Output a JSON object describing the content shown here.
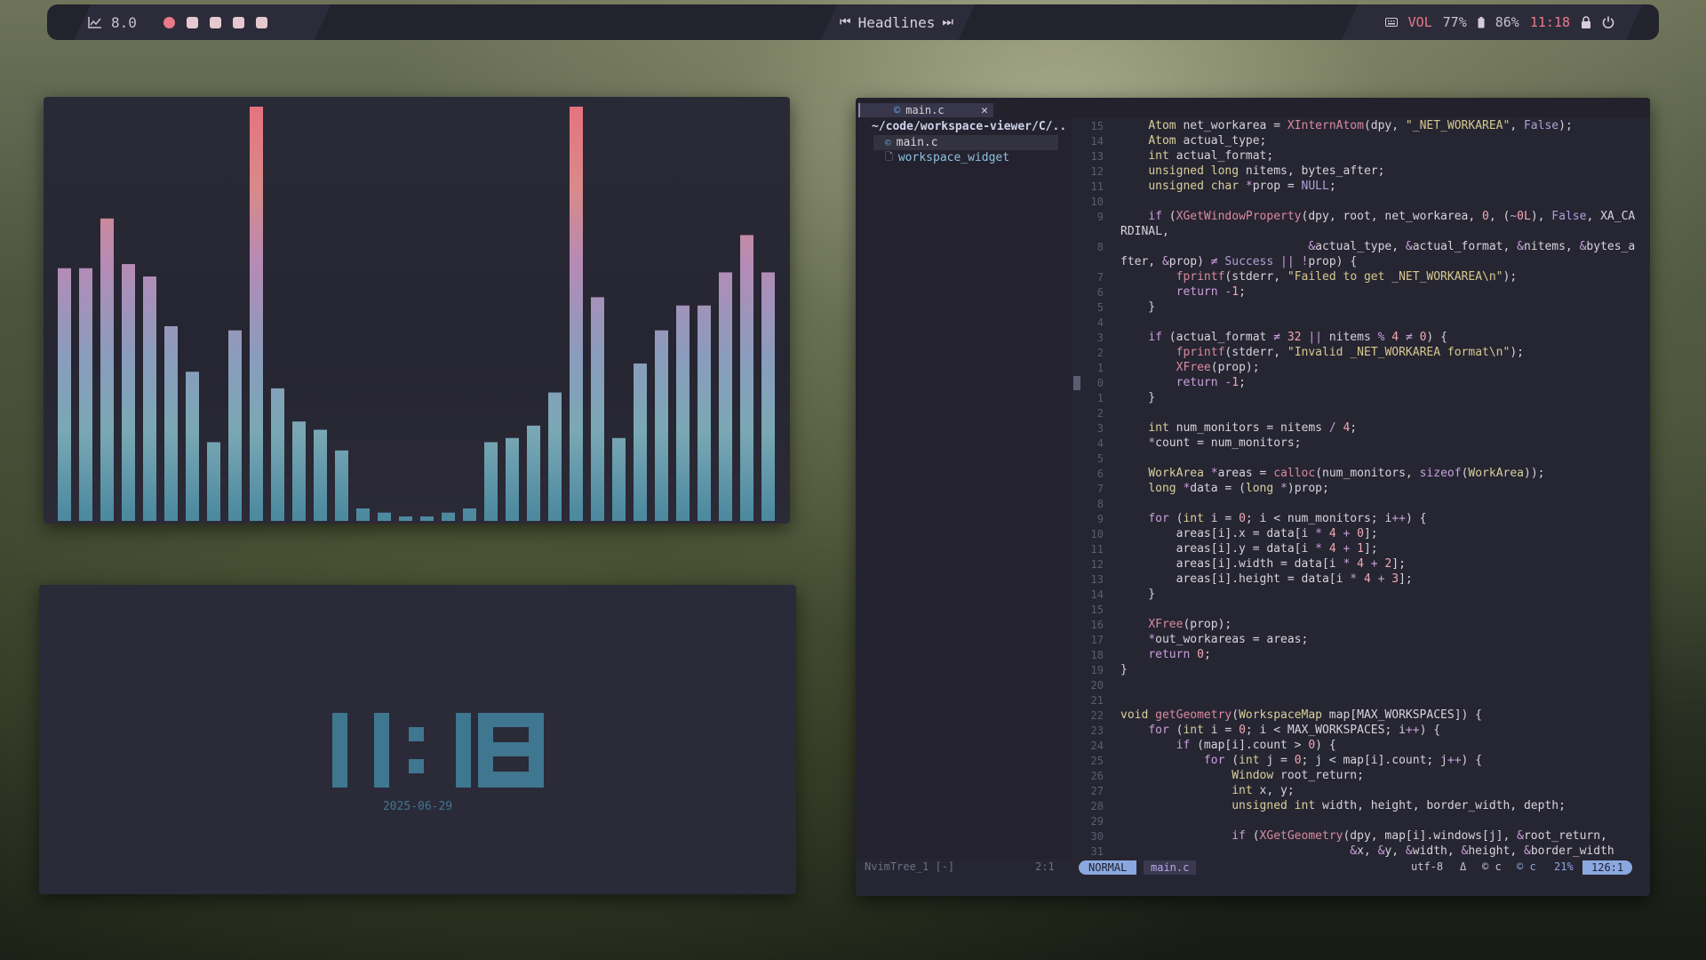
{
  "topbar": {
    "cpu_value": "8.0",
    "workspaces": [
      {
        "active": true
      },
      {
        "active": false
      },
      {
        "active": false
      },
      {
        "active": false
      },
      {
        "active": false
      }
    ],
    "media_title": "Headlines",
    "vol_label": "VOL",
    "vol_value": "77%",
    "battery_value": "86%",
    "time": "11:18",
    "colors": {
      "accent": "#ea7a88",
      "bar_bg": "#23232e"
    }
  },
  "visualizer": {
    "levels": [
      0.61,
      0.61,
      0.73,
      0.62,
      0.59,
      0.47,
      0.36,
      0.19,
      0.46,
      1.0,
      0.32,
      0.24,
      0.22,
      0.17,
      0.03,
      0.02,
      0.01,
      0.01,
      0.02,
      0.03,
      0.19,
      0.2,
      0.23,
      0.31,
      1.0,
      0.54,
      0.2,
      0.38,
      0.46,
      0.52,
      0.52,
      0.6,
      0.69,
      0.6
    ],
    "gradient": [
      "#e8707e",
      "#c58aa8",
      "#a789b8",
      "#7aa0b5",
      "#4f8aa0"
    ]
  },
  "clock": {
    "digits": "11:18",
    "date": "2025-06-29",
    "color": "#3f7690"
  },
  "editor": {
    "tab_name": "main.c",
    "tab_close": "✕",
    "tree": {
      "root": "~/code/workspace-viewer/C/..",
      "items": [
        {
          "name": "main.c",
          "icon": "c-file-icon",
          "selected": true
        },
        {
          "name": "workspace_widget",
          "icon": "file-icon",
          "selected": false
        }
      ]
    },
    "code_lines": [
      {
        "n": "15",
        "h": "    <span class=\"ty\">Atom</span> net_workarea = <span class=\"fn\">XInternAtom</span>(dpy, <span class=\"st\">\"_NET_WORKAREA\"</span>, <span class=\"cn\">False</span>);"
      },
      {
        "n": "14",
        "h": "    <span class=\"ty\">Atom</span> actual_type;"
      },
      {
        "n": "13",
        "h": "    <span class=\"ty\">int</span> actual_format;"
      },
      {
        "n": "12",
        "h": "    <span class=\"ty\">unsigned long</span> nitems, bytes_after;"
      },
      {
        "n": "11",
        "h": "    <span class=\"ty\">unsigned char</span> <span class=\"op\">*</span>prop = <span class=\"cn\">NULL</span>;"
      },
      {
        "n": "10",
        "h": ""
      },
      {
        "n": "9",
        "h": "    <span class=\"kw\">if</span> (<span class=\"fn\">XGetWindowProperty</span>(dpy, root, net_workarea, <span class=\"nm\">0</span>, (<span class=\"op\">~</span><span class=\"nm\">0L</span>), <span class=\"cn\">False</span>, XA_CA"
      },
      {
        "n": "",
        "h": "RDINAL,"
      },
      {
        "n": "8",
        "h": "                           <span class=\"op\">&amp;</span>actual_type, <span class=\"op\">&amp;</span>actual_format, <span class=\"op\">&amp;</span>nitems, <span class=\"op\">&amp;</span>bytes_a"
      },
      {
        "n": "",
        "h": "fter, <span class=\"op\">&amp;</span>prop) <span class=\"op\">≠</span> <span class=\"cn\">Success</span> <span class=\"op\">||</span> <span class=\"op\">!</span>prop) {"
      },
      {
        "n": "7",
        "h": "        <span class=\"fn\">fprintf</span>(stderr, <span class=\"st\">\"Failed to get _NET_WORKAREA\\n\"</span>);"
      },
      {
        "n": "6",
        "h": "        <span class=\"kw\">return</span> <span class=\"op\">-</span><span class=\"nm\">1</span>;"
      },
      {
        "n": "5",
        "h": "    }"
      },
      {
        "n": "4",
        "h": ""
      },
      {
        "n": "3",
        "h": "    <span class=\"kw\">if</span> (actual_format <span class=\"op\">≠</span> <span class=\"nm\">32</span> <span class=\"op\">||</span> nitems <span class=\"op\">%</span> <span class=\"nm\">4</span> <span class=\"op\">≠</span> <span class=\"nm\">0</span>) {"
      },
      {
        "n": "2",
        "h": "        <span class=\"fn\">fprintf</span>(stderr, <span class=\"st\">\"Invalid _NET_WORKAREA format\\n\"</span>);"
      },
      {
        "n": "1",
        "h": "        <span class=\"fn\">XFree</span>(prop);"
      },
      {
        "n": "0",
        "h": "        <span class=\"kw\">return</span> <span class=\"op\">-</span><span class=\"nm\">1</span>;",
        "cursor": true
      },
      {
        "n": "1",
        "h": "    }"
      },
      {
        "n": "2",
        "h": ""
      },
      {
        "n": "3",
        "h": "    <span class=\"ty\">int</span> num_monitors = nitems <span class=\"op\">/</span> <span class=\"nm\">4</span>;"
      },
      {
        "n": "4",
        "h": "    <span class=\"op\">*</span>count = num_monitors;"
      },
      {
        "n": "5",
        "h": ""
      },
      {
        "n": "6",
        "h": "    <span class=\"ty\">WorkArea</span> <span class=\"op\">*</span>areas = <span class=\"fn\">calloc</span>(num_monitors, <span class=\"kw\">sizeof</span>(<span class=\"ty\">WorkArea</span>));"
      },
      {
        "n": "7",
        "h": "    <span class=\"ty\">long</span> <span class=\"op\">*</span>data = (<span class=\"ty\">long</span> <span class=\"op\">*</span>)prop;"
      },
      {
        "n": "8",
        "h": ""
      },
      {
        "n": "9",
        "h": "    <span class=\"kw\">for</span> (<span class=\"ty\">int</span> i = <span class=\"nm\">0</span>; i &lt; num_monitors; i<span class=\"op\">++</span>) {"
      },
      {
        "n": "10",
        "h": "        areas[i].x = data[i <span class=\"op\">*</span> <span class=\"nm\">4</span> <span class=\"op\">+</span> <span class=\"nm\">0</span>];"
      },
      {
        "n": "11",
        "h": "        areas[i].y = data[i <span class=\"op\">*</span> <span class=\"nm\">4</span> <span class=\"op\">+</span> <span class=\"nm\">1</span>];"
      },
      {
        "n": "12",
        "h": "        areas[i].width = data[i <span class=\"op\">*</span> <span class=\"nm\">4</span> <span class=\"op\">+</span> <span class=\"nm\">2</span>];"
      },
      {
        "n": "13",
        "h": "        areas[i].height = data[i <span class=\"op\">*</span> <span class=\"nm\">4</span> <span class=\"op\">+</span> <span class=\"nm\">3</span>];"
      },
      {
        "n": "14",
        "h": "    }"
      },
      {
        "n": "15",
        "h": ""
      },
      {
        "n": "16",
        "h": "    <span class=\"fn\">XFree</span>(prop);"
      },
      {
        "n": "17",
        "h": "    <span class=\"op\">*</span>out_workareas = areas;"
      },
      {
        "n": "18",
        "h": "    <span class=\"kw\">return</span> <span class=\"nm\">0</span>;"
      },
      {
        "n": "19",
        "h": "}"
      },
      {
        "n": "20",
        "h": ""
      },
      {
        "n": "21",
        "h": ""
      },
      {
        "n": "22",
        "h": "<span class=\"ty\">void</span> <span class=\"fn\">getGeometry</span>(<span class=\"ty\">WorkspaceMap</span> map[MAX_WORKSPACES]) {"
      },
      {
        "n": "23",
        "h": "    <span class=\"kw\">for</span> (<span class=\"ty\">int</span> i = <span class=\"nm\">0</span>; i &lt; MAX_WORKSPACES; i<span class=\"op\">++</span>) {"
      },
      {
        "n": "24",
        "h": "        <span class=\"kw\">if</span> (map[i].count &gt; <span class=\"nm\">0</span>) {"
      },
      {
        "n": "25",
        "h": "            <span class=\"kw\">for</span> (<span class=\"ty\">int</span> j = <span class=\"nm\">0</span>; j &lt; map[i].count; j<span class=\"op\">++</span>) {"
      },
      {
        "n": "26",
        "h": "                <span class=\"ty\">Window</span> root_return;"
      },
      {
        "n": "27",
        "h": "                <span class=\"ty\">int</span> x, y;"
      },
      {
        "n": "28",
        "h": "                <span class=\"ty\">unsigned int</span> width, height, border_width, depth;"
      },
      {
        "n": "29",
        "h": ""
      },
      {
        "n": "30",
        "h": "                <span class=\"kw\">if</span> (<span class=\"fn\">XGetGeometry</span>(dpy, map[i].windows[j], <span class=\"op\">&amp;</span>root_return,"
      },
      {
        "n": "31",
        "h": "                                 <span class=\"op\">&amp;</span>x, <span class=\"op\">&amp;</span>y, <span class=\"op\">&amp;</span>width, <span class=\"op\">&amp;</span>height, <span class=\"op\">&amp;</span>border_width"
      }
    ],
    "status": {
      "tree_name": "NvimTree_1 [-]",
      "tree_pos": "2:1",
      "mode": "NORMAL",
      "file": "main.c",
      "encoding": "utf-8",
      "os_icon": "Δ",
      "filetype": "c",
      "filetype2": "c",
      "percent": "21%",
      "position": "126:1"
    }
  }
}
